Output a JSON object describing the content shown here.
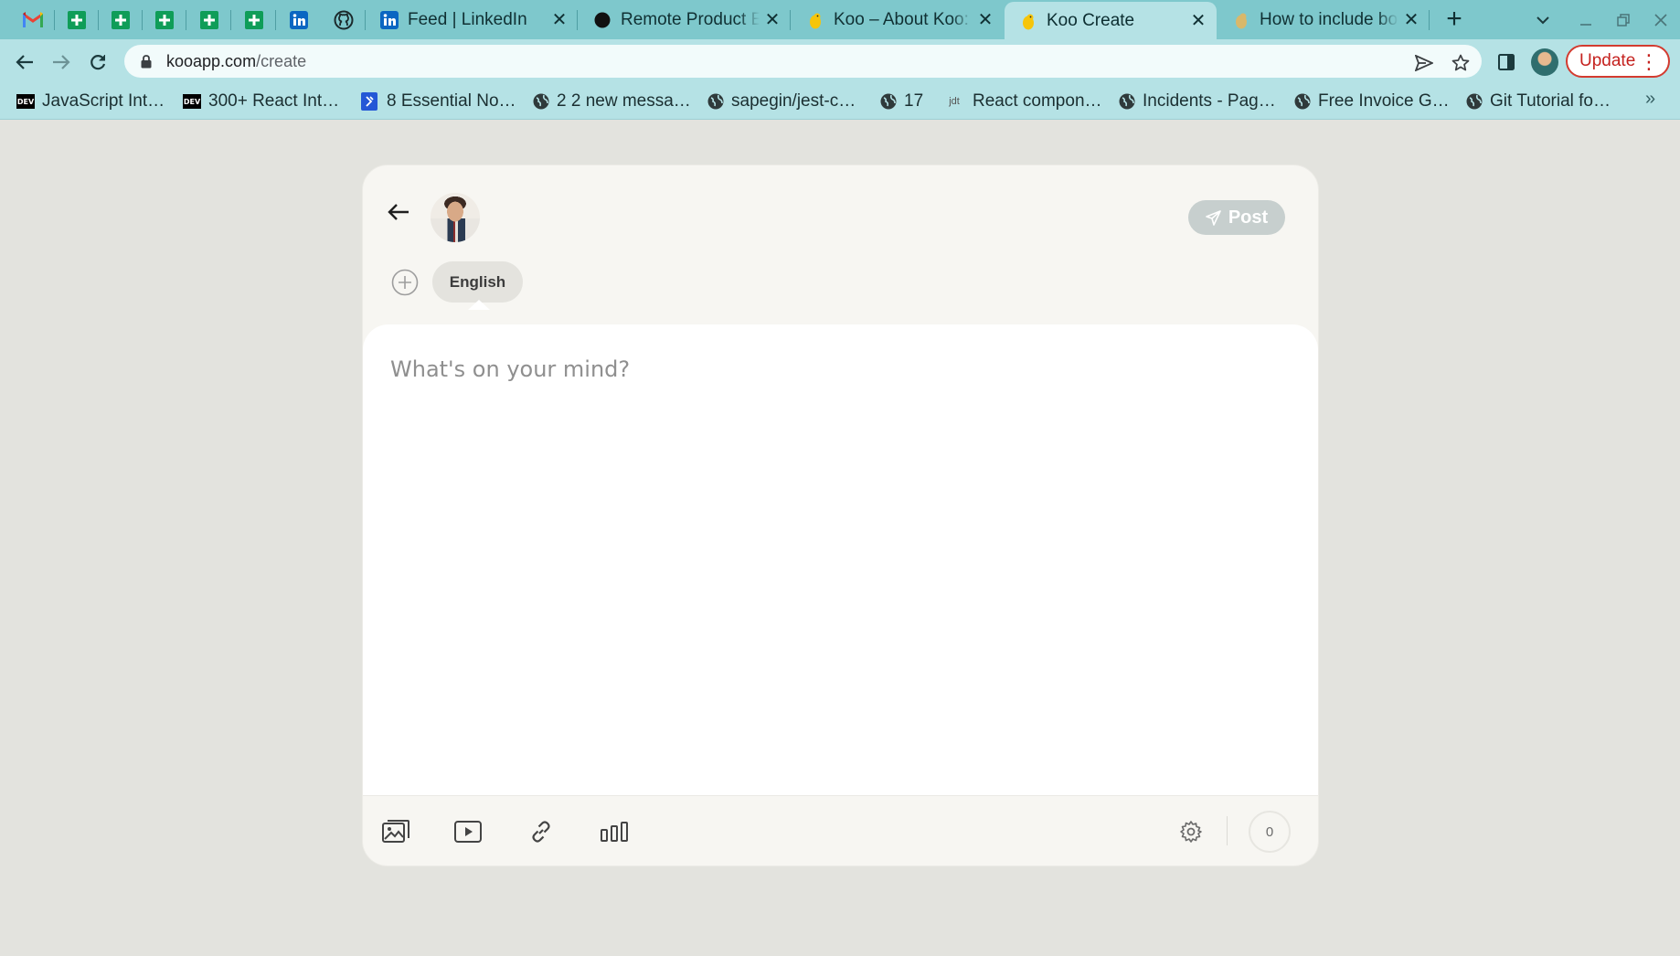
{
  "browser": {
    "pinned_tabs": [
      {
        "icon": "gmail-icon"
      },
      {
        "icon": "google-sheets-icon"
      },
      {
        "icon": "google-sheets-icon"
      },
      {
        "icon": "google-sheets-icon"
      },
      {
        "icon": "google-sheets-icon"
      },
      {
        "icon": "google-sheets-icon"
      },
      {
        "icon": "linkedin-icon"
      },
      {
        "icon": "github-icon"
      }
    ],
    "tabs": [
      {
        "title": "Feed | LinkedIn",
        "icon": "linkedin-icon",
        "active": false
      },
      {
        "title": "Remote Product E",
        "icon": "circle-icon",
        "active": false
      },
      {
        "title": "Koo – About Koo:",
        "icon": "koo-icon",
        "active": false
      },
      {
        "title": "Koo Create",
        "icon": "koo-icon",
        "active": true
      },
      {
        "title": "How to include bo",
        "icon": "koo-icon",
        "active": false
      }
    ],
    "new_tab_symbol": "+",
    "close_symbol": "✕",
    "url_host": "kooapp.com",
    "url_path": "/create",
    "update_label": "Update",
    "bookmarks": [
      {
        "label": "JavaScript Int…",
        "icon": "dev-icon"
      },
      {
        "label": "300+ React Int…",
        "icon": "dev-icon"
      },
      {
        "label": "8 Essential No…",
        "icon": "bookmark-blue-icon"
      },
      {
        "label": "2 2 new messa…",
        "icon": "globe-icon"
      },
      {
        "label": "sapegin/jest-c…",
        "icon": "globe-icon"
      },
      {
        "label": "17",
        "icon": "globe-icon"
      },
      {
        "label": "React compon…",
        "icon": "jdt-icon"
      },
      {
        "label": "Incidents - Pag…",
        "icon": "globe-icon"
      },
      {
        "label": "Free Invoice G…",
        "icon": "globe-icon"
      },
      {
        "label": "Git Tutorial fo…",
        "icon": "globe-icon"
      }
    ],
    "bookmarks_overflow": "»",
    "dev_badge": "DEV",
    "jdt_badge": "jdt"
  },
  "composer": {
    "post_label": "Post",
    "language_label": "English",
    "placeholder": "What's on your mind?",
    "char_count": "0",
    "toolbar_icons": [
      "image-gallery-icon",
      "video-icon",
      "link-icon",
      "poll-icon"
    ],
    "settings_icon": "gear-icon"
  },
  "colors": {
    "tab_strip": "#7ec8cc",
    "toolbar": "#b5e2e5",
    "page_bg": "#e3e3de",
    "card_bg": "#f7f6f2",
    "post_button": "#c7cfce",
    "update_border": "#d33b30"
  }
}
